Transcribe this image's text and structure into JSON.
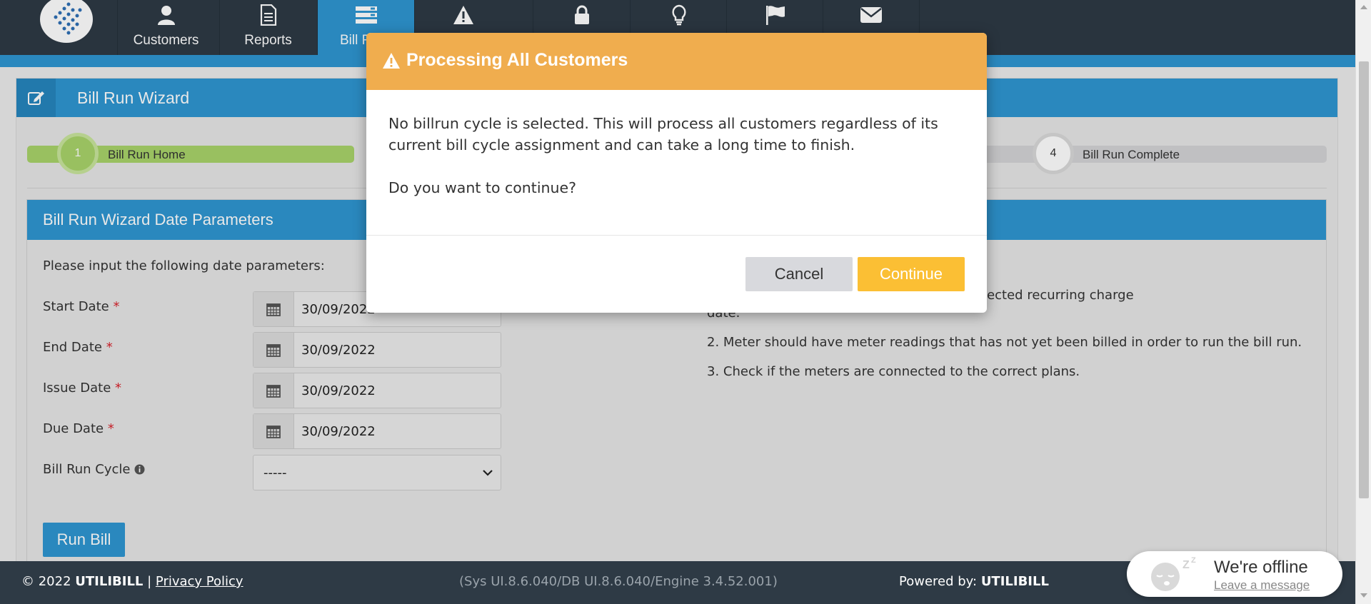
{
  "nav": {
    "items": [
      {
        "label": "Customers",
        "icon": "user-icon"
      },
      {
        "label": "Reports",
        "icon": "document-icon"
      },
      {
        "label": "Bill R",
        "icon": "billing-icon"
      },
      {
        "label": "",
        "icon": "warning-icon"
      },
      {
        "label": "",
        "icon": "lock-icon"
      },
      {
        "label": "",
        "icon": "lightbulb-icon"
      },
      {
        "label": "",
        "icon": "flag-icon"
      },
      {
        "label": "",
        "icon": "envelope-icon"
      }
    ]
  },
  "panel": {
    "title": "Bill Run Wizard",
    "steps": [
      {
        "number": "1",
        "label": "Bill Run Home"
      },
      {
        "number": "4",
        "label": "Bill Run Complete"
      }
    ]
  },
  "params": {
    "title": "Bill Run Wizard Date Parameters",
    "intro": "Please input the following date parameters:",
    "fields": [
      {
        "label": "Start Date",
        "value": "30/09/2022"
      },
      {
        "label": "End Date",
        "value": "30/09/2022"
      },
      {
        "label": "Issue Date",
        "value": "30/09/2022"
      },
      {
        "label": "Due Date",
        "value": "30/09/2022"
      }
    ],
    "cycle_label": "Bill Run Cycle",
    "cycle_value": "-----",
    "run_button": "Run Bill",
    "notes": [
      "ld be after the previous selected recurring charge",
      "date.",
      "2. Meter should have meter readings that has not yet been billed in order to run the bill run.",
      "3. Check if the meters are connected to the correct plans."
    ]
  },
  "modal": {
    "title": "Processing All Customers",
    "body_line1": "No billrun cycle is selected. This will process all customers regardless of its current bill cycle assignment and can take a long time to finish.",
    "body_line2": "Do you want to continue?",
    "cancel_label": "Cancel",
    "continue_label": "Continue"
  },
  "footer": {
    "copyright_prefix": "© 2022 ",
    "brand": "UTILIBILL",
    "separator": " | ",
    "privacy": "Privacy Policy",
    "version": "(Sys UI.8.6.040/DB UI.8.6.040/Engine 3.4.52.001)",
    "powered_prefix": "Powered by: ",
    "powered_brand": "UTILIBILL"
  },
  "chat": {
    "status": "We're offline",
    "action": "Leave a message"
  },
  "colors": {
    "nav_bg": "#2e3a45",
    "primary": "#2f96d1",
    "step_done": "#a9d46a",
    "warning_header": "#f0ad4e",
    "continue_button": "#fbbf34"
  }
}
